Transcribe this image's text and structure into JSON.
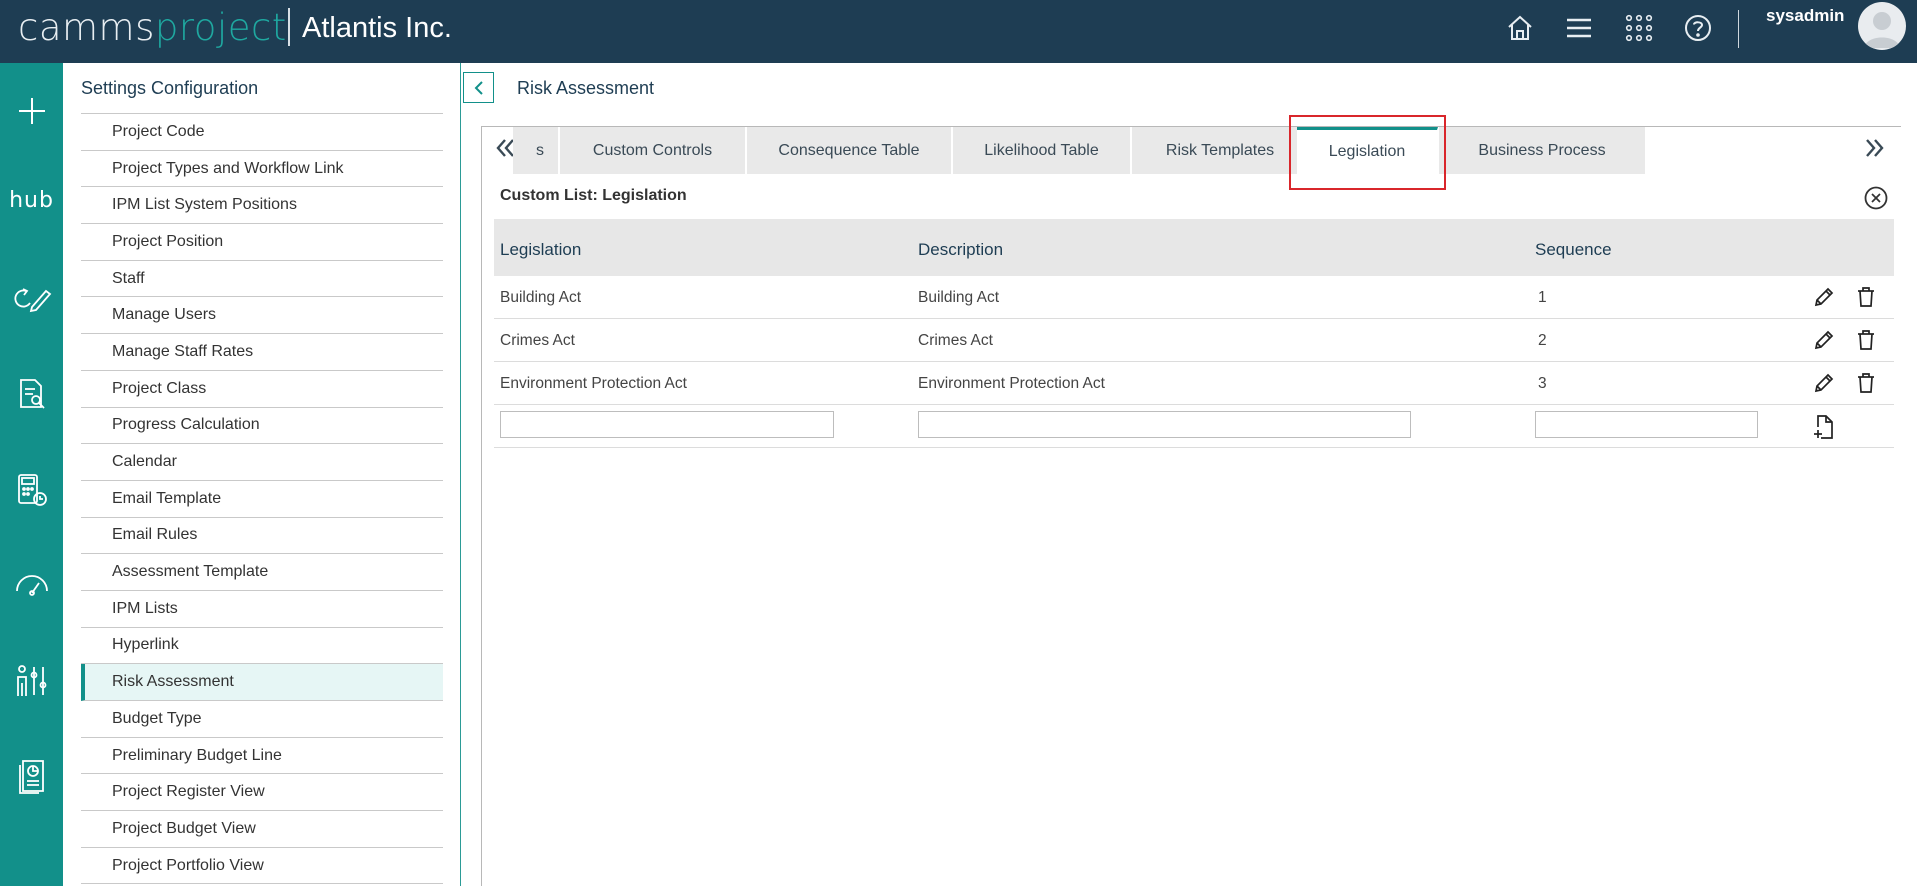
{
  "header": {
    "brand_part1": "camms",
    "brand_part2": "project",
    "company": "Atlantis Inc.",
    "username": "sysadmin",
    "icons": [
      "home-icon",
      "menu-icon",
      "apps-grid-icon",
      "help-icon"
    ]
  },
  "rail": {
    "hub_label": "hub",
    "icons": [
      "plus-icon",
      "hub-icon",
      "edit-cycle-icon",
      "document-search-icon",
      "calculator-clock-icon",
      "gauge-icon",
      "people-settings-icon",
      "report-icon"
    ]
  },
  "settings": {
    "title": "Settings Configuration",
    "items": [
      "Project Code",
      "Project Types and Workflow Link",
      "IPM List System Positions",
      "Project Position",
      "Staff",
      "Manage Users",
      "Manage Staff Rates",
      "Project Class",
      "Progress Calculation",
      "Calendar",
      "Email Template",
      "Email Rules",
      "Assessment Template",
      "IPM Lists",
      "Hyperlink",
      "Risk Assessment",
      "Budget Type",
      "Preliminary Budget Line",
      "Project Register View",
      "Project Budget View",
      "Project Portfolio View"
    ],
    "active_item": "Risk Assessment"
  },
  "main": {
    "title": "Risk Assessment",
    "tabs": [
      {
        "label": "s",
        "active": false
      },
      {
        "label": "Custom Controls",
        "active": false
      },
      {
        "label": "Consequence Table",
        "active": false
      },
      {
        "label": "Likelihood Table",
        "active": false
      },
      {
        "label": "Risk Templates",
        "active": false
      },
      {
        "label": "Legislation",
        "active": true
      },
      {
        "label": "Business Process",
        "active": false
      }
    ],
    "list_caption": "Custom List: Legislation",
    "columns": [
      "Legislation",
      "Description",
      "Sequence"
    ],
    "rows": [
      {
        "legislation": "Building Act",
        "description": "Building Act",
        "sequence": "1"
      },
      {
        "legislation": "Crimes Act",
        "description": "Crimes Act",
        "sequence": "2"
      },
      {
        "legislation": "Environment Protection Act",
        "description": "Environment Protection Act",
        "sequence": "3"
      }
    ],
    "new_row": {
      "legislation": "",
      "description": "",
      "sequence": ""
    }
  },
  "colors": {
    "header_bg": "#1e3d53",
    "rail_bg": "#12908a",
    "accent": "#12908a",
    "highlight": "#d9262b"
  }
}
